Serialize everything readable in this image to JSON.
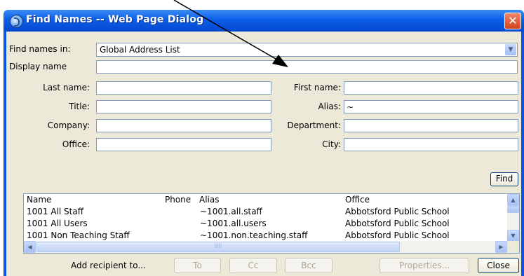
{
  "window": {
    "title": "Find Names -- Web Page Dialog",
    "close_glyph": "✕"
  },
  "form": {
    "find_names_in_label": "Find names in:",
    "find_names_in_value": "Global Address List",
    "display_name_label": "Display name",
    "display_name_value": "",
    "last_name_label": "Last name:",
    "last_name_value": "",
    "first_name_label": "First name:",
    "first_name_value": "",
    "title_label": "Title:",
    "title_value": "",
    "alias_label": "Alias:",
    "alias_value": "~",
    "company_label": "Company:",
    "company_value": "",
    "department_label": "Department:",
    "department_value": "",
    "office_label": "Office:",
    "office_value": "",
    "city_label": "City:",
    "city_value": "",
    "find_button": "Find"
  },
  "results": {
    "columns": {
      "name": "Name",
      "phone": "Phone",
      "alias": "Alias",
      "office": "Office"
    },
    "rows": [
      {
        "name": "1001 All Staff",
        "phone": "",
        "alias": "~1001.all.staff",
        "office": "Abbotsford Public School"
      },
      {
        "name": "1001 All Users",
        "phone": "",
        "alias": "~1001.all.users",
        "office": "Abbotsford Public School"
      },
      {
        "name": "1001 Non Teaching Staff",
        "phone": "",
        "alias": "~1001.non.teaching.staff",
        "office": "Abbotsford Public School"
      }
    ]
  },
  "bottom": {
    "add_recipient_label": "Add recipient to...",
    "to_button": "To",
    "cc_button": "Cc",
    "bcc_button": "Bcc",
    "properties_button": "Properties...",
    "close_button": "Close"
  },
  "scrollbar": {
    "thumb_grip": "IIII",
    "up": "▲",
    "down": "▼",
    "left": "◀",
    "right": "▶",
    "combo_arrow": "▼"
  }
}
